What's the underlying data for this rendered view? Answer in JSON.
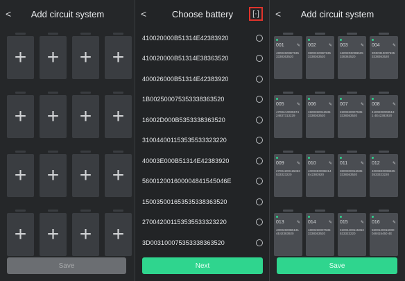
{
  "panel1": {
    "title": "Add circuit system",
    "back": "<",
    "slots": 16,
    "save_label": "Save"
  },
  "panel2": {
    "title": "Choose battery",
    "back": "<",
    "scan_icon": "scan-icon",
    "items": [
      "410020000B51314E42383920",
      "410020000B51314E38363520",
      "400026000B51314E42383920",
      "1B002500075353338363520",
      "16002D000B5353338363520",
      "310044001153535533323220",
      "40003E000B51314E42383920",
      "560012001600004841545046E",
      "150035001653535338363520",
      "270042001153535533323220",
      "3D003100075353338363520"
    ],
    "next_label": "Next"
  },
  "panel3": {
    "title": "Add circuit system",
    "back": "<",
    "batteries": [
      {
        "num": "001",
        "sn": "48002600B75353338363520"
      },
      {
        "num": "002",
        "sn": "38003100B75353338363520"
      },
      {
        "num": "003",
        "sn": "16002D000B535338363520"
      },
      {
        "num": "004",
        "sn": "3D003100075353338363520"
      },
      {
        "num": "005",
        "sn": "47002A000557424837313229"
      },
      {
        "num": "006",
        "sn": "15003500165353338363520"
      },
      {
        "num": "007",
        "sn": "22003200075353338363520"
      },
      {
        "num": "008",
        "sn": "41002000085131 4E42383920"
      },
      {
        "num": "009",
        "sn": "27004200115353533323220"
      },
      {
        "num": "010",
        "sn": "40003E000B314E42383920"
      },
      {
        "num": "011",
        "sn": "38003000165353338363520"
      },
      {
        "num": "012",
        "sn": "40003E000B5353533323220"
      },
      {
        "num": "013",
        "sn": "40002600B51314E42383920"
      },
      {
        "num": "014",
        "sn": "18002500075353338363520"
      },
      {
        "num": "015",
        "sn": "31004400115353533323220"
      },
      {
        "num": "016",
        "sn": "5600120016000048415450 4E"
      }
    ],
    "edit_icon": "edit-icon",
    "save_label": "Save"
  },
  "colors": {
    "accent": "#2fd58e",
    "panel_bg": "#252729",
    "slot_bg": "#3a3d41",
    "battery_bg": "#4a4d52",
    "scan_border": "#e0332b",
    "disabled_btn": "#6b6e72"
  }
}
